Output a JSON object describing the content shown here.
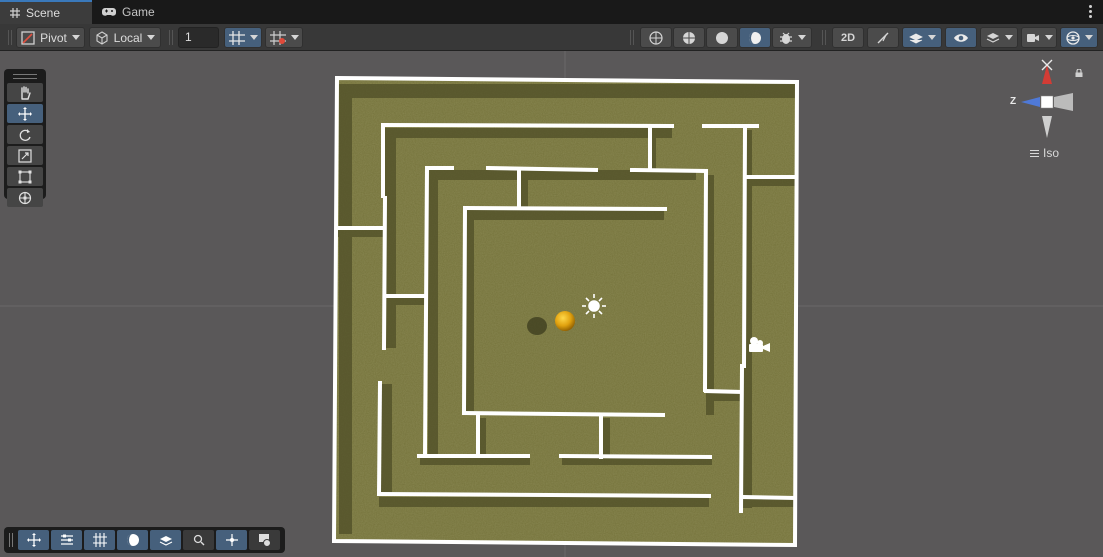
{
  "tabs": [
    {
      "label": "Scene",
      "icon": "grid-icon",
      "active": true
    },
    {
      "label": "Game",
      "icon": "gamepad-icon",
      "active": false
    }
  ],
  "toolbar": {
    "pivot_label": "Pivot",
    "local_label": "Local",
    "increment_value": "1",
    "mode_2d_label": "2D"
  },
  "tools": [
    "hand-tool",
    "move-tool",
    "rotate-tool",
    "scale-tool",
    "rect-tool",
    "transform-tool"
  ],
  "gizmo": {
    "z_label": "Z",
    "projection_label": "Iso"
  },
  "colors": {
    "accent": "#46607c",
    "viewport_bg": "#5a5859",
    "grass": "#74723a",
    "wall": "#ffffff",
    "ball": "#e1a20f"
  }
}
